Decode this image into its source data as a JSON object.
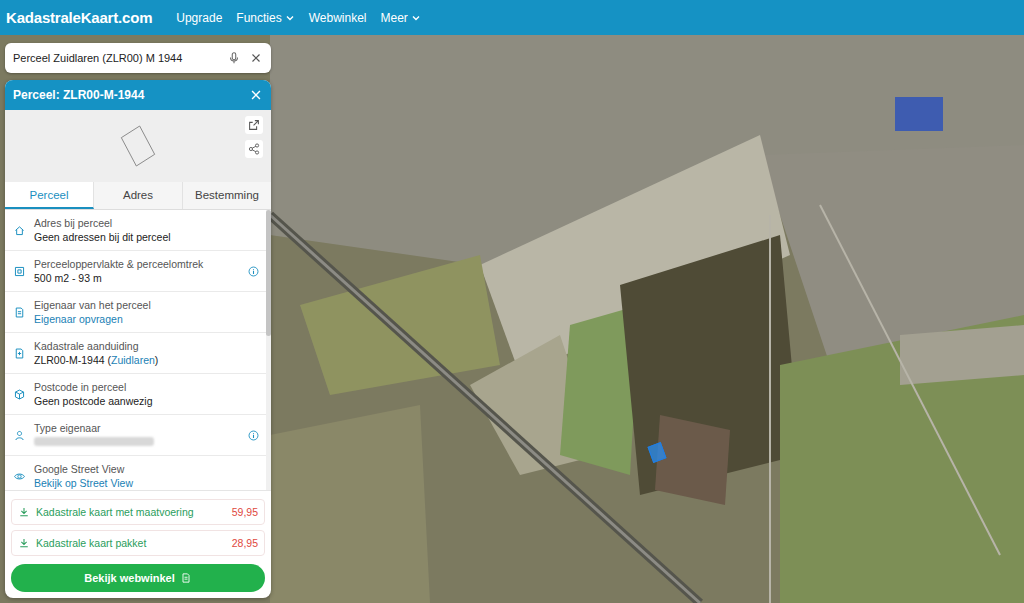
{
  "logo": "KadastraleKaart.com",
  "nav": [
    {
      "label": "Upgrade",
      "dropdown": false
    },
    {
      "label": "Functies",
      "dropdown": true
    },
    {
      "label": "Webwinkel",
      "dropdown": false
    },
    {
      "label": "Meer",
      "dropdown": true
    }
  ],
  "search": {
    "value": "Perceel Zuidlaren (ZLR00) M 1944"
  },
  "panel": {
    "title": "Perceel: ZLR00-M-1944",
    "tabs": [
      {
        "label": "Perceel",
        "selected": true
      },
      {
        "label": "Adres",
        "selected": false
      },
      {
        "label": "Bestemming",
        "selected": false
      }
    ],
    "rows": [
      {
        "label": "Adres bij perceel",
        "value": [
          {
            "text": "Geen adressen bij dit perceel",
            "link": false
          }
        ],
        "info": false,
        "blurred": false
      },
      {
        "label": "Perceeloppervlakte & perceelomtrek",
        "value": [
          {
            "text": "500 m2 - 93 m",
            "link": false
          }
        ],
        "info": true,
        "blurred": false
      },
      {
        "label": "Eigenaar van het perceel",
        "value": [
          {
            "text": "Eigenaar opvragen",
            "link": true
          }
        ],
        "info": false,
        "blurred": false
      },
      {
        "label": "Kadastrale aanduiding",
        "value": [
          {
            "text": "ZLR00-M-1944 (",
            "link": false
          },
          {
            "text": "Zuidlaren",
            "link": true
          },
          {
            "text": ")",
            "link": false
          }
        ],
        "info": false,
        "blurred": false
      },
      {
        "label": "Postcode in perceel",
        "value": [
          {
            "text": "Geen postcode aanwezig",
            "link": false
          }
        ],
        "info": false,
        "blurred": false
      },
      {
        "label": "Type eigenaar",
        "value": [],
        "info": true,
        "blurred": true
      },
      {
        "label": "Google Street View",
        "value": [
          {
            "text": "Bekijk op Street View",
            "link": true
          }
        ],
        "info": false,
        "blurred": false
      }
    ],
    "downloads": [
      {
        "label": "Kadastrale kaart met maatvoering",
        "price": "59,95"
      },
      {
        "label": "Kadastrale kaart pakket",
        "price": "28,95"
      }
    ],
    "button": "Bekijk webwinkel"
  },
  "map": {
    "parcel": {
      "highlighted": true
    }
  }
}
